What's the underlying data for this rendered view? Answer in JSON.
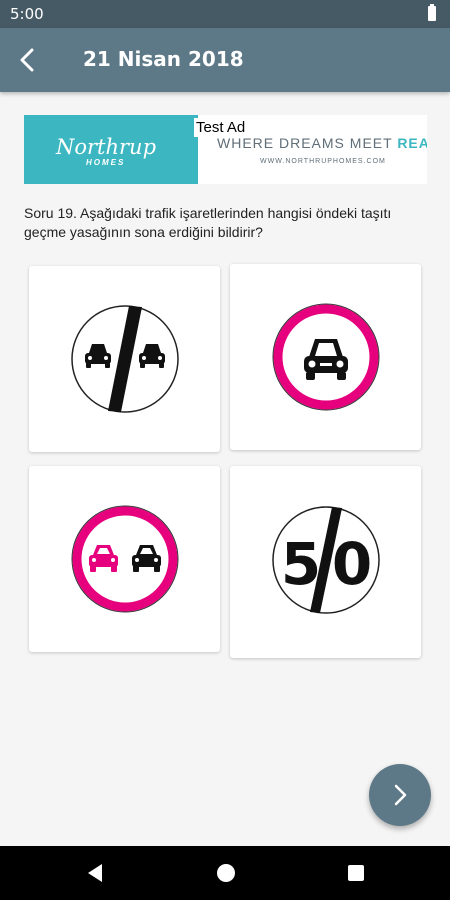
{
  "status_bar": {
    "time": "5:00"
  },
  "app_bar": {
    "title": "21 Nisan 2018"
  },
  "ad": {
    "label": "Test Ad",
    "logo_name": "Northrup",
    "logo_sub": "HOMES",
    "slogan_main": "WHERE DREAMS MEET ",
    "slogan_accent": "REA",
    "url": "WWW.NORTHRUPHOMES.COM"
  },
  "question": {
    "text": "Soru 19. Aşağıdaki trafik işaretlerinden hangisi öndeki taşıtı geçme yasağının sona erdiğini bildirir?"
  },
  "options": [
    {
      "sign": "end-of-no-overtaking"
    },
    {
      "sign": "no-cars"
    },
    {
      "sign": "no-overtaking"
    },
    {
      "sign": "end-of-speed-limit",
      "number_left": "5",
      "number_right": "0"
    }
  ],
  "colors": {
    "ring_magenta": "#e6007e",
    "app_bar": "#5d7987",
    "status_bar": "#465a66",
    "ad_teal": "#3cb7c2"
  }
}
